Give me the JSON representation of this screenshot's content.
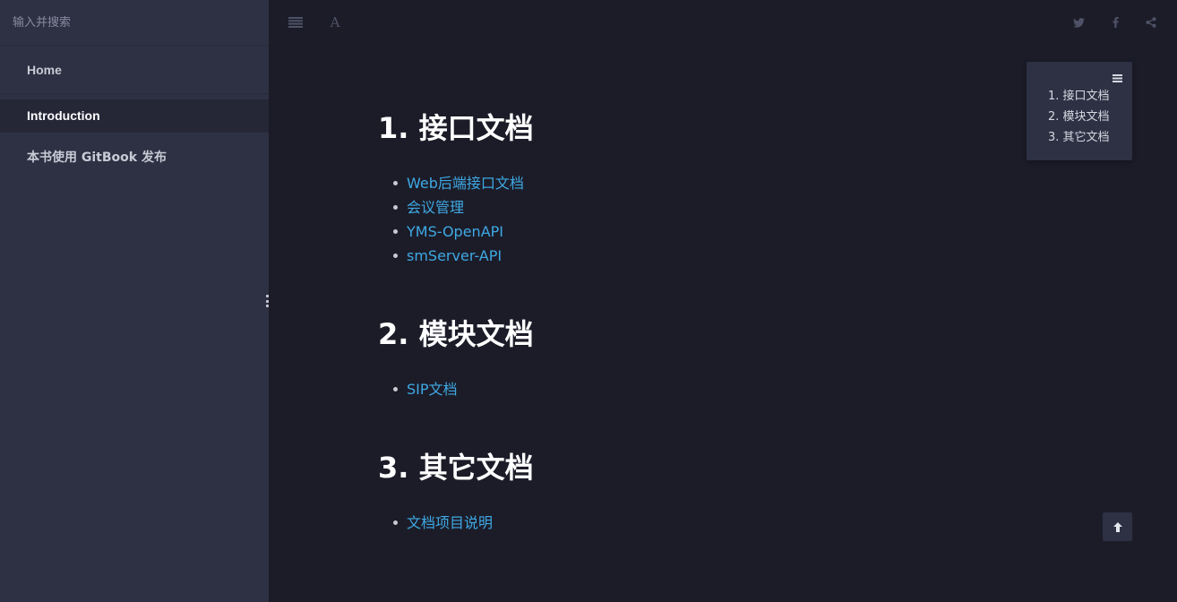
{
  "sidebar": {
    "search_placeholder": "输入并搜索",
    "items": [
      {
        "label": "Home",
        "active": false
      },
      {
        "label": "Introduction",
        "active": true
      },
      {
        "label": "本书使用 GitBook 发布",
        "active": false
      }
    ]
  },
  "toolbar": {
    "left_icons": [
      "menu-icon",
      "font-settings-icon"
    ],
    "font_glyph": "A",
    "right_icons": [
      "twitter-icon",
      "facebook-icon",
      "share-icon"
    ]
  },
  "content": {
    "sections": [
      {
        "heading": "1. 接口文档",
        "links": [
          "Web后端接口文档",
          "会议管理",
          "YMS-OpenAPI",
          "smServer-API"
        ]
      },
      {
        "heading": "2. 模块文档",
        "links": [
          "SIP文档"
        ]
      },
      {
        "heading": "3. 其它文档",
        "links": [
          "文档项目说明"
        ]
      }
    ]
  },
  "toc": {
    "icon": "list-icon",
    "items": [
      {
        "num": "1.",
        "label": "接口文档"
      },
      {
        "num": "2.",
        "label": "模块文档"
      },
      {
        "num": "3.",
        "label": "其它文档"
      }
    ]
  },
  "back_to_top": {
    "icon": "arrow-up-icon"
  },
  "colors": {
    "sidebar_bg": "#2d3143",
    "main_bg": "#1c1c29",
    "link": "#3ea9e3",
    "heading": "#ffffff"
  }
}
